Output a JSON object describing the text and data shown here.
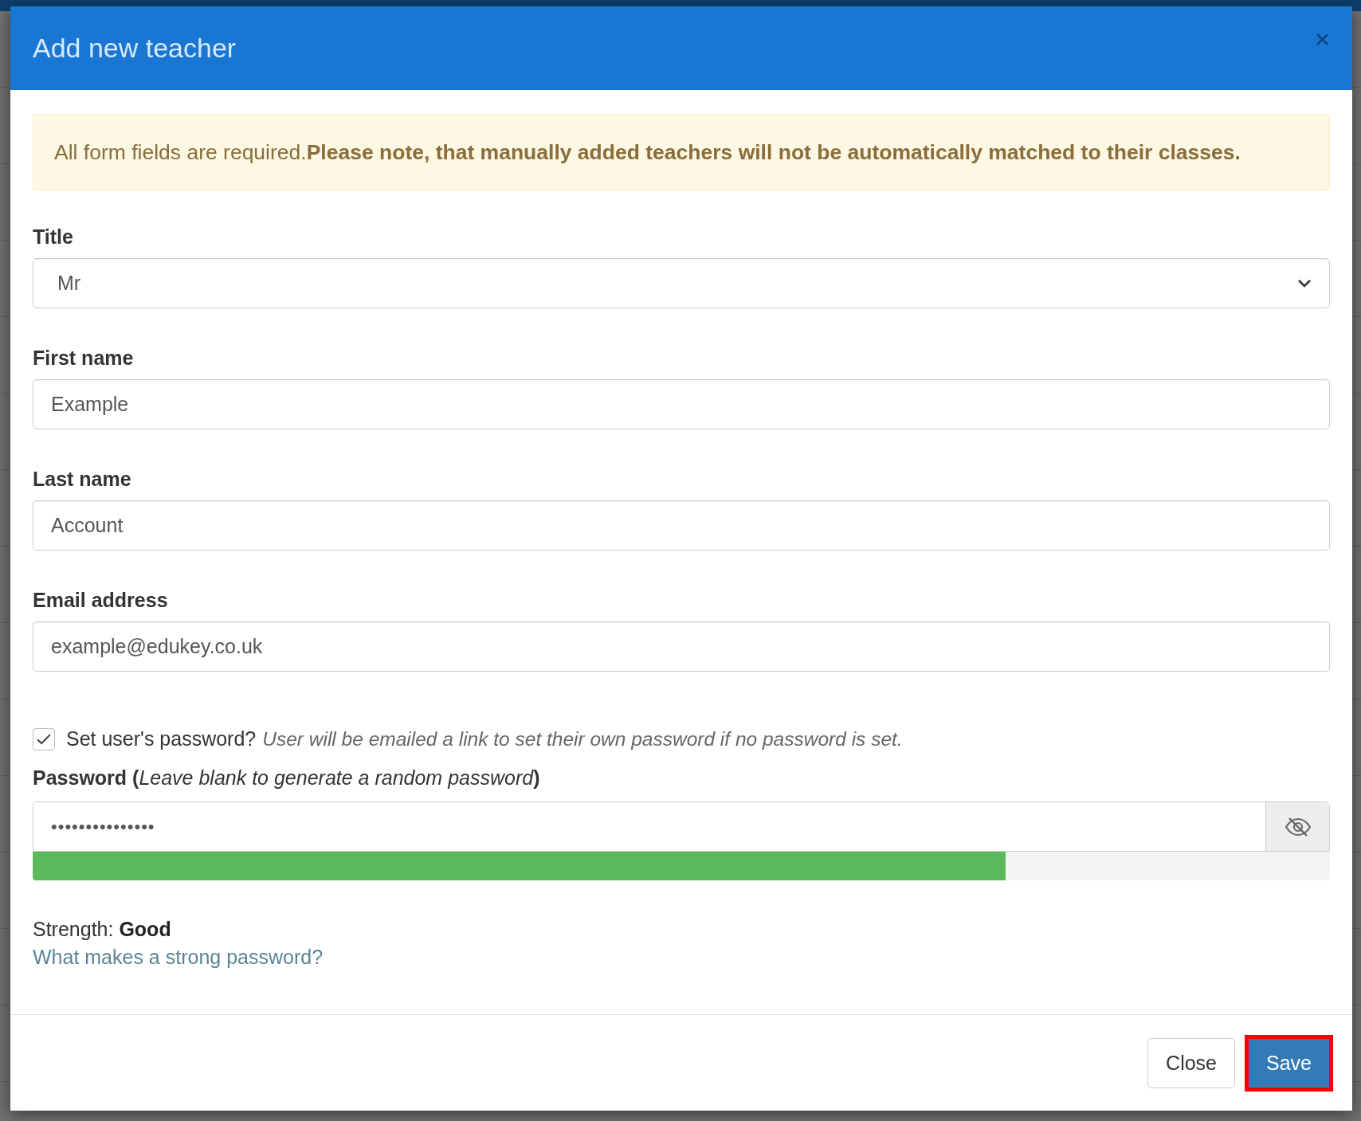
{
  "dialog": {
    "title": "Add new teacher",
    "close": "×"
  },
  "alert": "All form fields are required.**Please note, that manually added teachers will not be automatically matched to their classes.**",
  "fields": [
    {
      "kind": "select",
      "label": "Title",
      "value": "Mr"
    },
    {
      "kind": "text",
      "label": "First name",
      "value": "Example"
    },
    {
      "kind": "text",
      "label": "Last name",
      "value": "Account"
    },
    {
      "kind": "text",
      "label": "Email address",
      "value": "example@edukey.co.uk"
    }
  ],
  "set_password": {
    "checked": true,
    "label": "Set user's password?",
    "hint": "User will be emailed a link to set their own password if no password is set."
  },
  "password": {
    "label": "Password (*Leave blank to generate a random password*)",
    "value": "•••••••••••••••",
    "level": 0.75,
    "strength_label": "Strength:",
    "strength": "Good",
    "help_link": "What makes a strong password?"
  },
  "buttons": [
    {
      "label": "Close",
      "kind": "default",
      "highlighted": false
    },
    {
      "label": "Save",
      "kind": "primary",
      "highlighted": true
    }
  ]
}
